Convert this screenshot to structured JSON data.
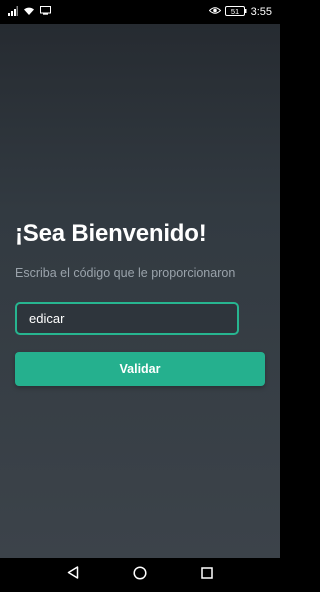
{
  "status_bar": {
    "battery": "51",
    "time": "3:55"
  },
  "welcome": {
    "title": "¡Sea Bienvenido!",
    "subtitle": "Escriba el código que le proporcionaron"
  },
  "code_input": {
    "value": "edicar"
  },
  "validate_button": {
    "label": "Validar"
  },
  "colors": {
    "accent": "#25b08e",
    "background_top": "#262b31",
    "background_bottom": "#3c434a"
  },
  "icons": [
    "signal-icon",
    "wifi-icon",
    "screen-icon",
    "eye-icon",
    "battery-icon",
    "back-icon",
    "home-icon",
    "recents-icon"
  ]
}
